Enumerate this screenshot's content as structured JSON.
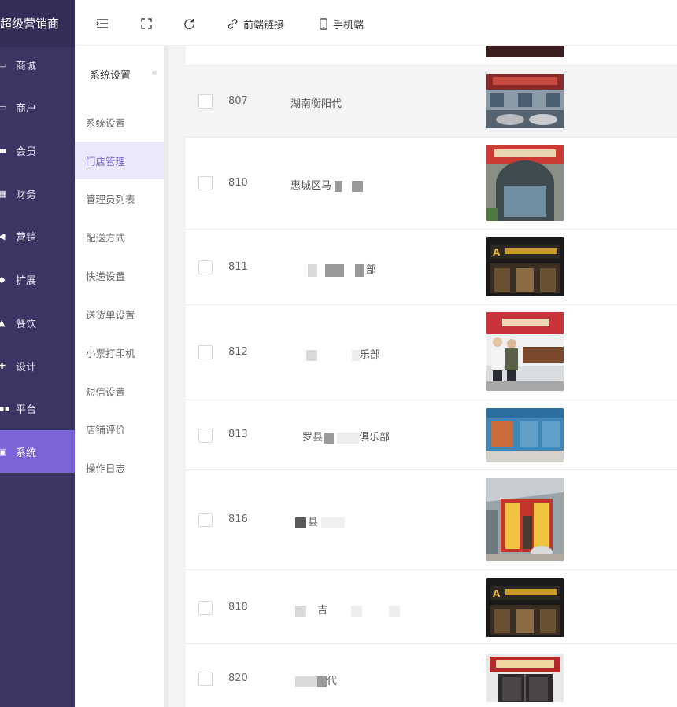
{
  "sidebar": {
    "brand": "超级营销商",
    "items": [
      {
        "label": "商城",
        "icon": "monitor-icon"
      },
      {
        "label": "商户",
        "icon": "monitor-icon"
      },
      {
        "label": "会员",
        "icon": "card-icon"
      },
      {
        "label": "财务",
        "icon": "ledger-icon"
      },
      {
        "label": "营销",
        "icon": "megaphone-icon"
      },
      {
        "label": "扩展",
        "icon": "cube-icon"
      },
      {
        "label": "餐饮",
        "icon": "cloche-icon"
      },
      {
        "label": "设计",
        "icon": "puzzle-icon"
      },
      {
        "label": "平台",
        "icon": "grid-icon"
      },
      {
        "label": "系统",
        "icon": "chart-icon"
      }
    ],
    "active": "系统"
  },
  "toolbar": {
    "menu_icon": "menu-fold-icon",
    "fullscreen_icon": "fullscreen-icon",
    "refresh_icon": "refresh-icon",
    "frontend_link": "前端链接",
    "mobile": "手机端"
  },
  "subnav": {
    "title": "系统设置",
    "collapse": "«",
    "items": [
      "系统设置",
      "门店管理",
      "管理员列表",
      "配送方式",
      "快递设置",
      "送货单设置",
      "小票打印机",
      "短信设置",
      "店铺评价",
      "操作日志"
    ],
    "active": "门店管理"
  },
  "table": {
    "rows": [
      {
        "id": "807",
        "name": "湖南衡阳代",
        "image": "store-photo-1"
      },
      {
        "id": "810",
        "name": "惠城区马",
        "image": "store-photo-2"
      },
      {
        "id": "811",
        "name": "部",
        "image": "store-photo-3"
      },
      {
        "id": "812",
        "name": "乐部",
        "image": "store-photo-4"
      },
      {
        "id": "813",
        "name": "罗县",
        "name2": "俱乐部",
        "image": "store-photo-5"
      },
      {
        "id": "816",
        "name": "县",
        "image": "store-photo-6"
      },
      {
        "id": "818",
        "name": "吉",
        "image": "store-photo-7"
      },
      {
        "id": "820",
        "name": "代",
        "image": "store-photo-8"
      }
    ]
  },
  "colors": {
    "sidebar_bg": "#3b3564",
    "accent": "#7a64d8",
    "active_sub_bg": "#ece8fb"
  }
}
